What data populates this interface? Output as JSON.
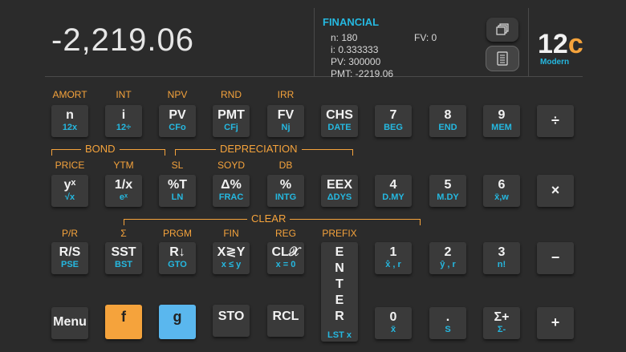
{
  "display": {
    "value": "-2,219.06"
  },
  "registers": {
    "title": "FINANCIAL",
    "n": "n: 180",
    "i": "i: 0.333333",
    "pv": "PV: 300000",
    "pmt": "PMT: -2219.06",
    "fv": "FV: 0"
  },
  "logo": {
    "main": "12",
    "accent": "c",
    "sub": "Modern"
  },
  "side_buttons": [
    {
      "icon": "copy-icon"
    },
    {
      "icon": "memo-icon"
    }
  ],
  "colors": {
    "background": "#2b2b2b",
    "key": "#3a3a3a",
    "f_orange": "#f5a33c",
    "g_blue": "#25b8e0",
    "g_key": "#5ab7ee"
  },
  "row1": {
    "f": [
      "AMORT",
      "INT",
      "NPV",
      "RND",
      "IRR"
    ],
    "keys": [
      {
        "main": "n",
        "g": "12x"
      },
      {
        "main": "i",
        "g": "12÷"
      },
      {
        "main": "PV",
        "g": "CFo"
      },
      {
        "main": "PMT",
        "g": "CFj"
      },
      {
        "main": "FV",
        "g": "Nj"
      },
      {
        "main": "CHS",
        "g": "DATE"
      },
      {
        "main": "7",
        "g": "BEG"
      },
      {
        "main": "8",
        "g": "END"
      },
      {
        "main": "9",
        "g": "MEM"
      },
      {
        "main": "÷",
        "g": ""
      }
    ]
  },
  "brackets": {
    "bond": "BOND",
    "depreciation": "DEPRECIATION",
    "clear": "CLEAR"
  },
  "row2": {
    "f": [
      "PRICE",
      "YTM",
      "SL",
      "SOYD",
      "DB"
    ],
    "keys": [
      {
        "main": "yˣ",
        "g": "√x"
      },
      {
        "main": "1/x",
        "g": "eˣ"
      },
      {
        "main": "%T",
        "g": "LN"
      },
      {
        "main": "Δ%",
        "g": "FRAC"
      },
      {
        "main": "%",
        "g": "INTG"
      },
      {
        "main": "EEX",
        "g": "ΔDYS"
      },
      {
        "main": "4",
        "g": "D.MY"
      },
      {
        "main": "5",
        "g": "M.DY"
      },
      {
        "main": "6",
        "g": "x̄,w"
      },
      {
        "main": "×",
        "g": ""
      }
    ]
  },
  "row3": {
    "f": [
      "P/R",
      "Σ",
      "PRGM",
      "FIN",
      "REG",
      "PREFIX"
    ],
    "keys": [
      {
        "main": "R/S",
        "g": "PSE"
      },
      {
        "main": "SST",
        "g": "BST"
      },
      {
        "main": "R↓",
        "g": "GTO"
      },
      {
        "main": "X≷Y",
        "g": "x ≤ y"
      },
      {
        "main": "CL𝒳",
        "g": "x = 0"
      },
      {
        "main": "1",
        "g": "x̂ , r"
      },
      {
        "main": "2",
        "g": "ŷ , r"
      },
      {
        "main": "3",
        "g": "n!"
      },
      {
        "main": "−",
        "g": ""
      }
    ],
    "enter": {
      "letters": [
        "E",
        "N",
        "T",
        "E",
        "R"
      ],
      "g": "LST x"
    }
  },
  "row4": {
    "keys": [
      {
        "main": "Menu",
        "g": ""
      },
      {
        "main": "f",
        "g": ""
      },
      {
        "main": "g",
        "g": ""
      },
      {
        "main": "STO",
        "g": ""
      },
      {
        "main": "RCL",
        "g": ""
      },
      {
        "main": "0",
        "g": "x̄"
      },
      {
        "main": ".",
        "g": "S"
      },
      {
        "main": "Σ+",
        "g": "Σ-"
      },
      {
        "main": "+",
        "g": ""
      }
    ]
  }
}
